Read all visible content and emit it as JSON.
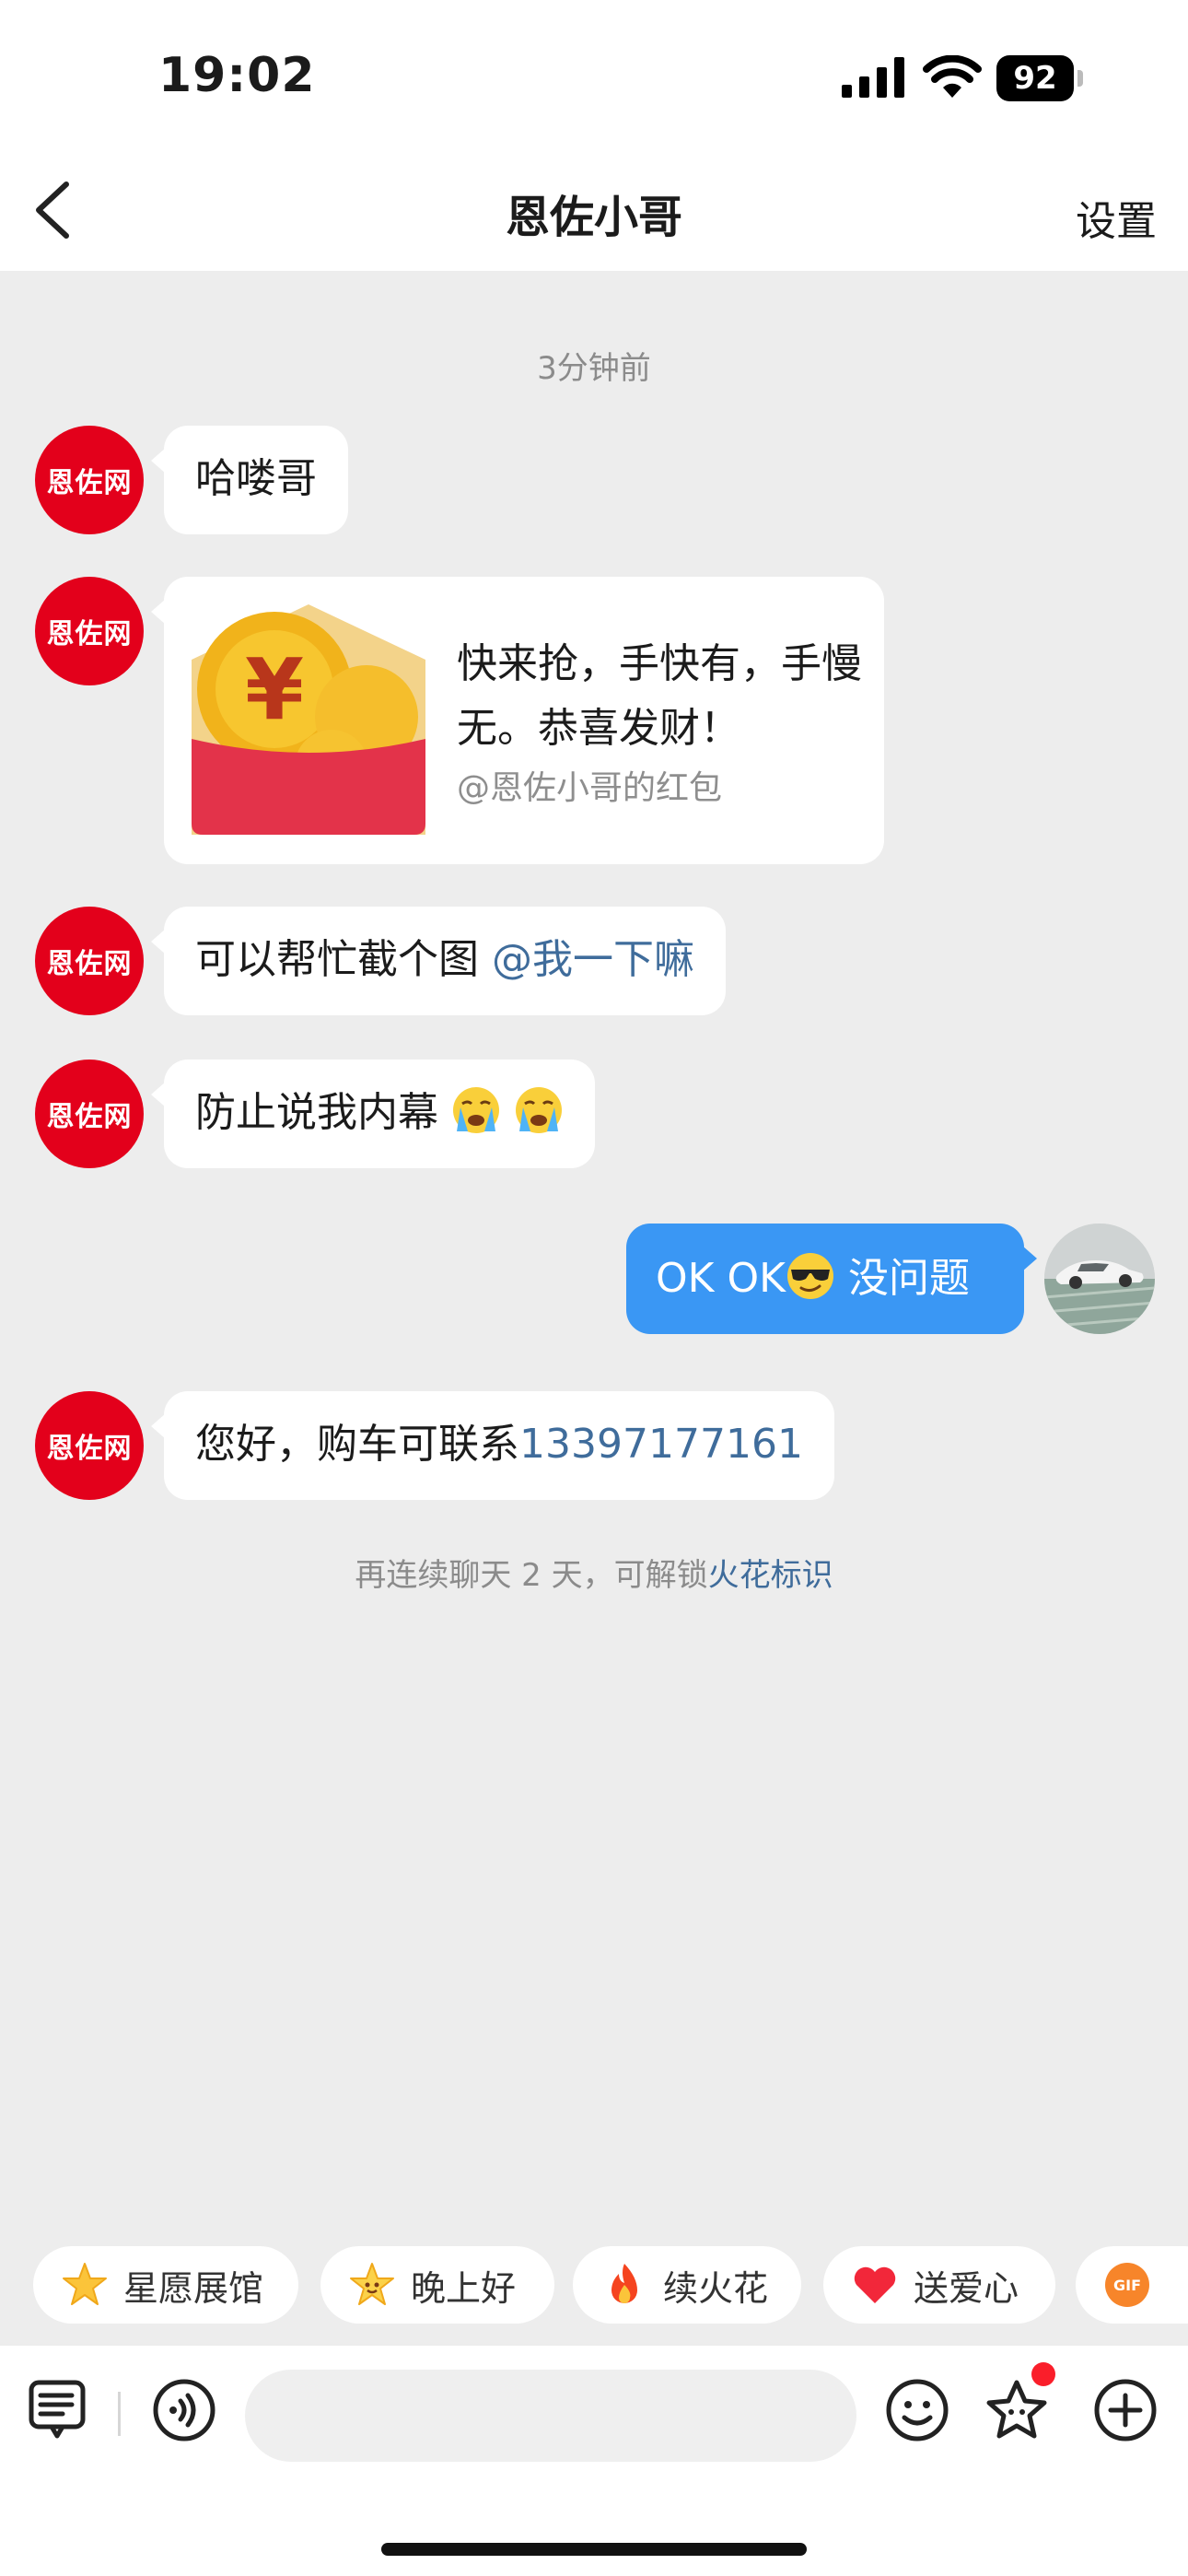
{
  "status": {
    "time": "19:02",
    "battery": "92"
  },
  "nav": {
    "title": "恩佐小哥",
    "settings": "设置"
  },
  "chat": {
    "timestamp": "3分钟前",
    "avatar_label": "恩佐网",
    "messages": [
      {
        "text": "哈喽哥"
      },
      {
        "packet_title": "快来抢，手快有，手慢无。恭喜发财！",
        "packet_sub": "@恩佐小哥的红包"
      },
      {
        "text": "可以帮忙截个图",
        "mention": "@我一下嘛"
      },
      {
        "text": "防止说我内幕"
      },
      {
        "self_before": "OK OK",
        "self_after": "没问题"
      },
      {
        "text": "您好，购车可联系",
        "phone": "13397177161"
      }
    ],
    "hint_prefix": "再连续聊天 2 天，可解锁",
    "hint_link": "火花标识"
  },
  "chips": [
    {
      "label": "星愿展馆",
      "icon": "star-icon"
    },
    {
      "label": "晚上好",
      "icon": "smiling-star-icon"
    },
    {
      "label": "续火花",
      "icon": "fire-icon"
    },
    {
      "label": "送爱心",
      "icon": "heart-icon"
    },
    {
      "label": "GIF",
      "icon": "gif-icon"
    }
  ],
  "colors": {
    "brand_red": "#e3001b",
    "self_bubble": "#3a97f4",
    "link": "#3f6c9b",
    "background": "#ededed"
  }
}
